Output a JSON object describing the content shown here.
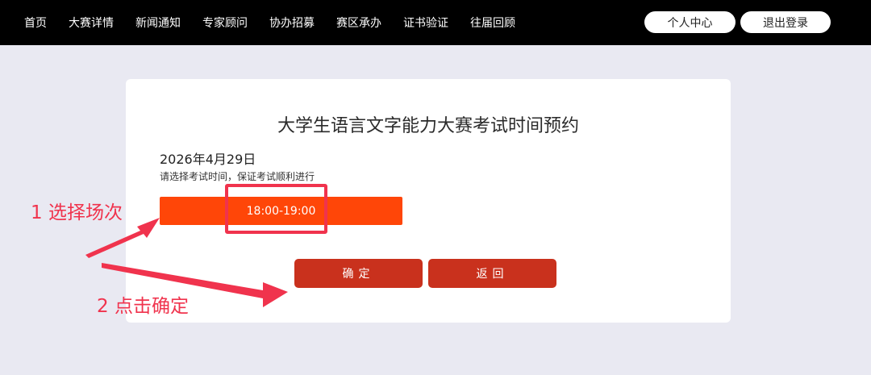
{
  "nav": {
    "items": [
      {
        "label": "首页"
      },
      {
        "label": "大赛详情"
      },
      {
        "label": "新闻通知"
      },
      {
        "label": "专家顾问"
      },
      {
        "label": "协办招募"
      },
      {
        "label": "赛区承办"
      },
      {
        "label": "证书验证"
      },
      {
        "label": "往届回顾"
      }
    ],
    "user_center": "个人中心",
    "logout": "退出登录"
  },
  "booking": {
    "title": "大学生语言文字能力大赛考试时间预约",
    "date": "2026年4月29日",
    "hint": "请选择考试时间，保证考试顺利进行",
    "slot": "18:00-19:00",
    "confirm": "确定",
    "back": "返回"
  },
  "annotations": {
    "step1": "1 选择场次",
    "step2": "2 点击确定"
  },
  "colors": {
    "slot": "#ff4608",
    "action_button": "#c9311d",
    "annotation": "#f0334d",
    "topbar": "#000000",
    "background": "#e9e9f2"
  }
}
